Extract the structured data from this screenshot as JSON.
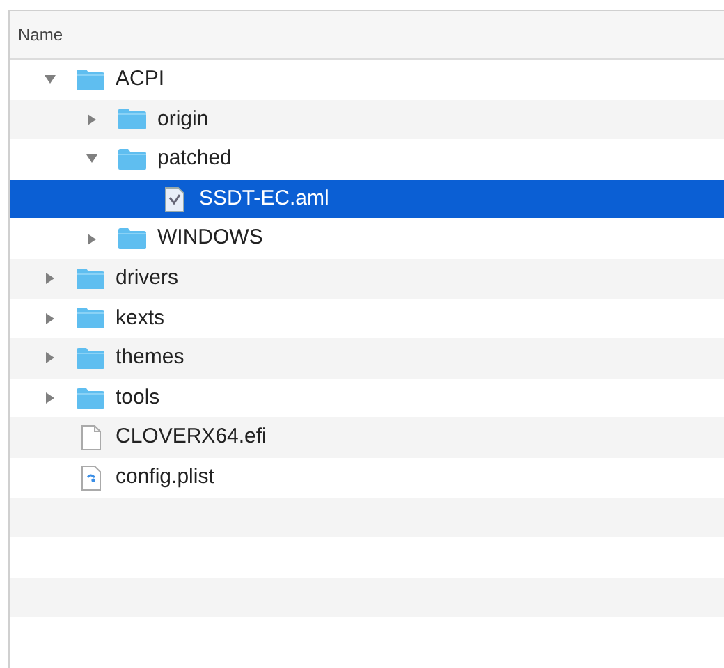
{
  "table": {
    "columns": [
      "Name"
    ],
    "tree": [
      {
        "name": "ACPI",
        "kind": "folder",
        "expanded": true,
        "selected": false,
        "children": [
          {
            "name": "origin",
            "kind": "folder",
            "expanded": false,
            "selected": false
          },
          {
            "name": "patched",
            "kind": "folder",
            "expanded": true,
            "selected": false,
            "children": [
              {
                "name": "SSDT-EC.aml",
                "kind": "aml",
                "selected": true
              }
            ]
          },
          {
            "name": "WINDOWS",
            "kind": "folder",
            "expanded": false,
            "selected": false
          }
        ]
      },
      {
        "name": "drivers",
        "kind": "folder",
        "expanded": false,
        "selected": false
      },
      {
        "name": "kexts",
        "kind": "folder",
        "expanded": false,
        "selected": false
      },
      {
        "name": "themes",
        "kind": "folder",
        "expanded": false,
        "selected": false
      },
      {
        "name": "tools",
        "kind": "folder",
        "expanded": false,
        "selected": false
      },
      {
        "name": "CLOVERX64.efi",
        "kind": "efi",
        "selected": false
      },
      {
        "name": "config.plist",
        "kind": "plist",
        "selected": false
      }
    ]
  }
}
